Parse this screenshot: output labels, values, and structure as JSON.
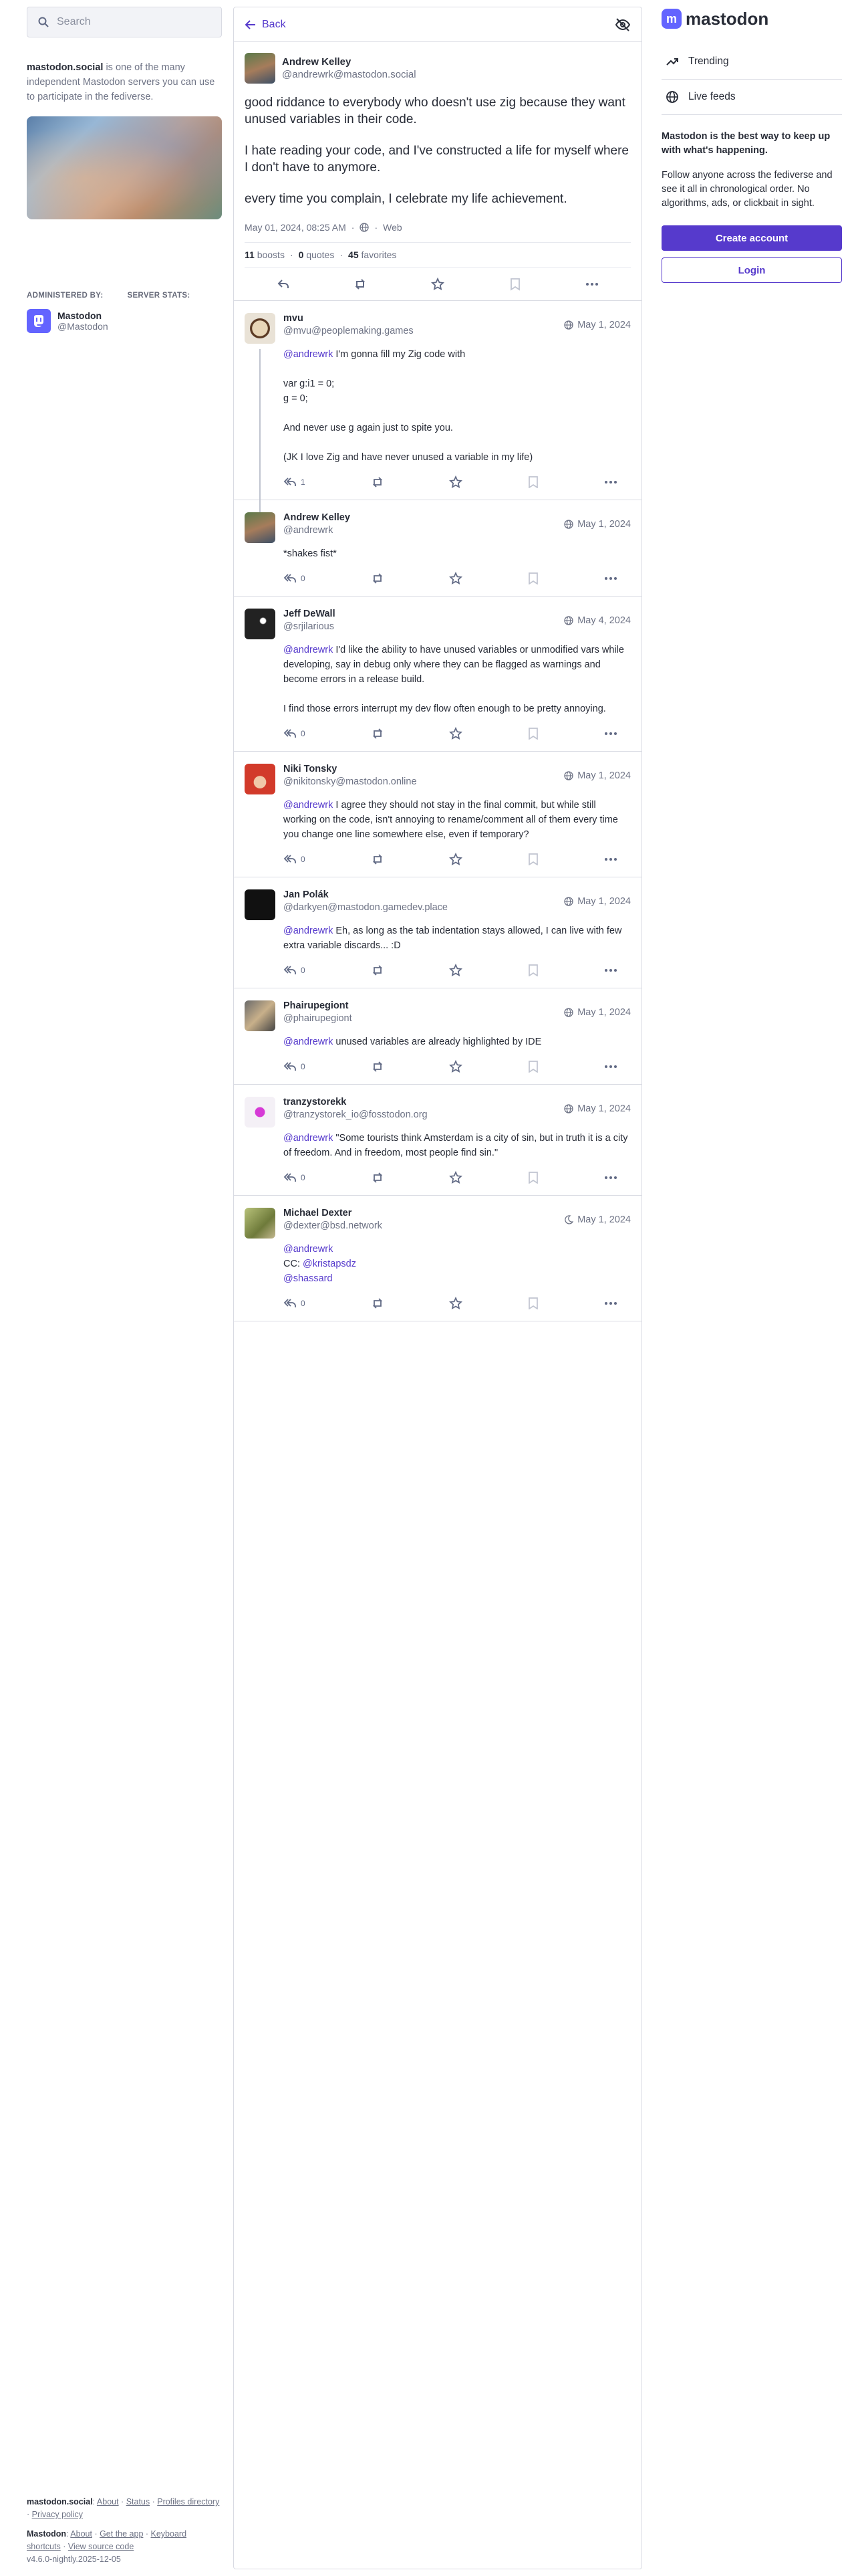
{
  "left": {
    "search_placeholder": "Search",
    "server_name": "mastodon.social",
    "server_desc": " is one of the many independent Mastodon servers you can use to participate in the fediverse.",
    "administered_by": "ADMINISTERED BY:",
    "server_stats": "SERVER STATS:",
    "admin_name": "Mastodon",
    "admin_handle": "@Mastodon",
    "footer": {
      "server": "mastodon.social",
      "about": "About",
      "status": "Status",
      "profiles_directory": "Profiles directory",
      "privacy": "Privacy policy",
      "mastodon": "Mastodon",
      "about2": "About",
      "get_app": "Get the app",
      "keyboard": "Keyboard shortcuts",
      "source": "View source code",
      "version": "v4.6.0-nightly.2025-12-05"
    }
  },
  "header": {
    "back_label": "Back"
  },
  "main": {
    "name": "Andrew Kelley",
    "handle": "@andrewrk@mastodon.social",
    "p1": "good riddance to everybody who doesn't use zig because they want unused variables in their code.",
    "p2": "I hate reading your code, and I've constructed a life for myself where I don't have to anymore.",
    "p3": "every time you complain, I celebrate my life achievement.",
    "date": "May 01, 2024, 08:25 AM",
    "via": "Web",
    "boosts": "11",
    "boosts_label": "boosts",
    "quotes": "0",
    "quotes_label": "quotes",
    "favs": "45",
    "favs_label": "favorites"
  },
  "replies": [
    {
      "name": "mvu",
      "handle": "@mvu@peoplemaking.games",
      "date": "May 1, 2024",
      "mention": "@andrewrk",
      "text": " I'm gonna fill my Zig code with",
      "code1": "var g:i1 = 0;",
      "code2": "g = 0;",
      "p2": "And never use g again just to spite you.",
      "p3": "(JK I love Zig and have never unused a variable in my life)",
      "count": "1"
    },
    {
      "name": "Andrew Kelley",
      "handle": "@andrewrk",
      "date": "May 1, 2024",
      "text": "*shakes fist*",
      "count": "0"
    },
    {
      "name": "Jeff DeWall",
      "handle": "@srjilarious",
      "date": "May 4, 2024",
      "mention": "@andrewrk",
      "text": " I'd like the ability to have unused variables or unmodified vars while developing, say in debug only where they can be flagged as warnings and become errors in a release build.",
      "p2": "I find those errors interrupt my dev flow often enough to be pretty annoying.",
      "count": "0"
    },
    {
      "name": "Niki Tonsky",
      "handle": "@nikitonsky@mastodon.online",
      "date": "May 1, 2024",
      "mention": "@andrewrk",
      "text": " I agree they should not stay in the final commit, but while still working on the code, isn't annoying to rename/comment all of them every time you change one line somewhere else, even if temporary?",
      "count": "0"
    },
    {
      "name": "Jan Polák",
      "handle": "@darkyen@mastodon.gamedev.place",
      "date": "May 1, 2024",
      "mention": "@andrewrk",
      "text": " Eh, as long as the tab indentation stays allowed, I can live with few extra variable discards... :D",
      "count": "0"
    },
    {
      "name": "Phairupegiont",
      "handle": "@phairupegiont",
      "date": "May 1, 2024",
      "mention": "@andrewrk",
      "text": " unused variables are already highlighted by IDE",
      "count": "0"
    },
    {
      "name": "tranzystorekk",
      "handle": "@tranzystorek_io@fosstodon.org",
      "date": "May 1, 2024",
      "mention": "@andrewrk",
      "text": " \"Some tourists think Amsterdam is a city of sin, but in truth it is a city of freedom. And in freedom, most people find sin.\"",
      "count": "0"
    },
    {
      "name": "Michael Dexter",
      "handle": "@dexter@bsd.network",
      "date": "May 1, 2024",
      "mention": "@andrewrk",
      "cc": "CC: ",
      "m2": "@kristapsdz",
      "m3": "@shassard",
      "count": "0"
    }
  ],
  "right": {
    "logo": "mastodon",
    "trending": "Trending",
    "live_feeds": "Live feeds",
    "promo_title": "Mastodon is the best way to keep up with what's happening.",
    "promo_body": "Follow anyone across the fediverse and see it all in chronological order. No algorithms, ads, or clickbait in sight.",
    "create_account": "Create account",
    "login": "Login"
  },
  "colors": {
    "accent": "#563acc",
    "brand": "#6364ff"
  }
}
